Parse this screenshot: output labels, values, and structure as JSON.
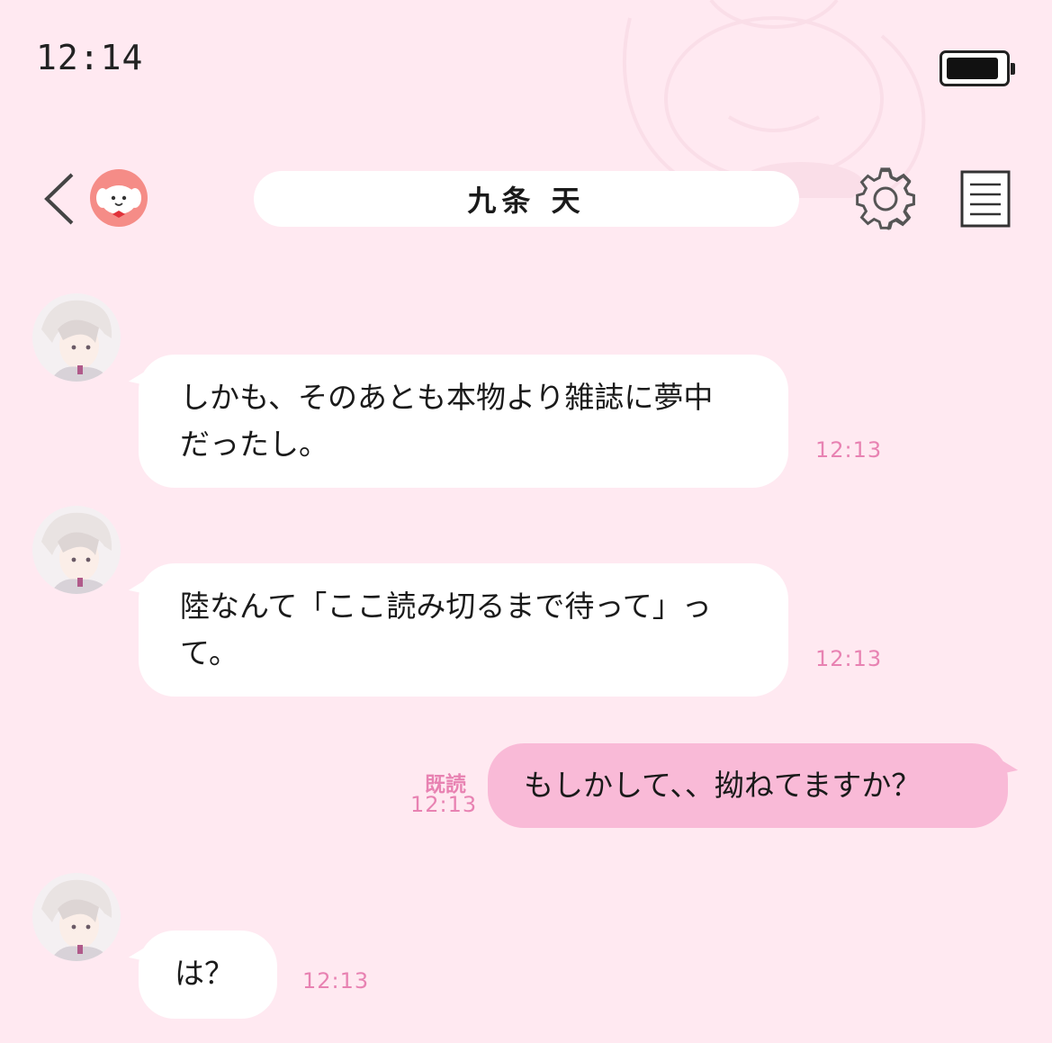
{
  "status_bar": {
    "time": "12:14",
    "battery_level": 0.92
  },
  "header": {
    "contact_name": "九条 天",
    "icons": {
      "back": "chevron-left-icon",
      "avatar": "bunny-avatar-icon",
      "settings": "gear-icon",
      "menu": "document-list-icon"
    }
  },
  "messages": [
    {
      "sender": "other",
      "lines": [
        "しかも、そのあとも本物より雑誌に夢中",
        "だったし。"
      ],
      "time": "12:13"
    },
    {
      "sender": "other",
      "lines": [
        "陸なんて「ここ読み切るまで待って」っ",
        "て。"
      ],
      "time": "12:13"
    },
    {
      "sender": "me",
      "lines": [
        "もしかして、、拗ねてますか？"
      ],
      "read_label": "既読",
      "time": "12:13"
    },
    {
      "sender": "other",
      "lines": [
        "は？"
      ],
      "time": "12:13"
    }
  ],
  "colors": {
    "background": "#ffe9f1",
    "my_bubble": "#f9bad7",
    "their_bubble": "#ffffff",
    "timestamp": "#e882b2"
  }
}
